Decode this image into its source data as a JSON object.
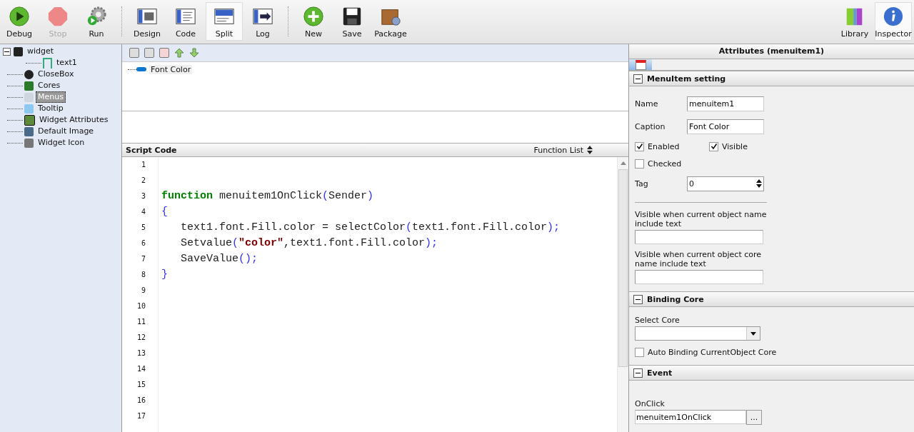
{
  "toolbar": {
    "groups": [
      [
        {
          "label": "Debug",
          "disabled": false,
          "selected": false
        },
        {
          "label": "Stop",
          "disabled": true,
          "selected": false
        },
        {
          "label": "Run",
          "disabled": false,
          "selected": false
        }
      ],
      [
        {
          "label": "Design",
          "disabled": false,
          "selected": false
        },
        {
          "label": "Code",
          "disabled": false,
          "selected": false
        },
        {
          "label": "Split",
          "disabled": false,
          "selected": true
        },
        {
          "label": "Log",
          "disabled": false,
          "selected": false
        }
      ],
      [
        {
          "label": "New",
          "disabled": false,
          "selected": false
        },
        {
          "label": "Save",
          "disabled": false,
          "selected": false
        },
        {
          "label": "Package",
          "disabled": false,
          "selected": false
        }
      ]
    ],
    "right": [
      {
        "label": "Library",
        "disabled": false,
        "selected": false
      },
      {
        "label": "Inspector",
        "disabled": false,
        "selected": true
      }
    ]
  },
  "tree": [
    {
      "label": "widget",
      "selected": false,
      "expanded": true,
      "children": [
        {
          "label": "text1",
          "selected": false
        }
      ]
    },
    {
      "label": "CloseBox",
      "selected": false
    },
    {
      "label": "Cores",
      "selected": false
    },
    {
      "label": "Menus",
      "selected": true
    },
    {
      "label": "Tooltip",
      "selected": false
    },
    {
      "label": "Widget Attributes",
      "selected": false
    },
    {
      "label": "Default Image",
      "selected": false
    },
    {
      "label": "Widget Icon",
      "selected": false
    }
  ],
  "menu_tree": [
    {
      "label": "Font Color",
      "selected": true
    }
  ],
  "script": {
    "title": "Script Code",
    "function_list": "Function List",
    "lines": [
      {
        "number": "1"
      },
      {
        "number": "2"
      },
      {
        "number": "3",
        "tokens": [
          {
            "kind": "keyword",
            "text": "function"
          },
          {
            "kind": "plain",
            "text": " menuitem1OnClick"
          },
          {
            "kind": "punct",
            "text": "("
          },
          {
            "kind": "plain",
            "text": "Sender"
          },
          {
            "kind": "punct",
            "text": ")"
          }
        ]
      },
      {
        "number": "4",
        "tokens": [
          {
            "kind": "punct",
            "text": "{"
          }
        ]
      },
      {
        "number": "5",
        "tokens": [
          {
            "kind": "plain",
            "text": "   text1.font.Fill.color = selectColor"
          },
          {
            "kind": "punct",
            "text": "("
          },
          {
            "kind": "plain",
            "text": "text1.font.Fill.color"
          },
          {
            "kind": "punct",
            "text": ");"
          }
        ]
      },
      {
        "number": "6",
        "tokens": [
          {
            "kind": "plain",
            "text": "   Setvalue"
          },
          {
            "kind": "punct",
            "text": "("
          },
          {
            "kind": "string",
            "text": "\"color\""
          },
          {
            "kind": "plain",
            "text": ",text1.font.Fill.color"
          },
          {
            "kind": "punct",
            "text": ");"
          }
        ]
      },
      {
        "number": "7",
        "tokens": [
          {
            "kind": "plain",
            "text": "   SaveValue"
          },
          {
            "kind": "punct",
            "text": "();"
          }
        ]
      },
      {
        "number": "8",
        "tokens": [
          {
            "kind": "punct",
            "text": "}"
          }
        ]
      },
      {
        "number": "9"
      },
      {
        "number": "10"
      },
      {
        "number": "11"
      },
      {
        "number": "12"
      },
      {
        "number": "13"
      },
      {
        "number": "14"
      },
      {
        "number": "15"
      },
      {
        "number": "16"
      },
      {
        "number": "17"
      }
    ]
  },
  "inspector": {
    "title": "Attributes (menuitem1)",
    "sections": [
      {
        "title": "MenuItem setting",
        "rows": [
          {
            "kind": "field",
            "label": "Name",
            "value": "menuitem1"
          },
          {
            "kind": "field",
            "label": "Caption",
            "value": "Font Color"
          },
          {
            "kind": "checks",
            "items": [
              {
                "label": "Enabled",
                "checked": true
              },
              {
                "label": "Visible",
                "checked": true
              }
            ]
          },
          {
            "kind": "checks",
            "items": [
              {
                "label": "Checked",
                "checked": false
              }
            ]
          },
          {
            "kind": "spin",
            "label": "Tag",
            "value": "0"
          },
          {
            "kind": "rule"
          },
          {
            "kind": "wide",
            "label": "Visible when current object name include text"
          },
          {
            "kind": "wide",
            "label": "Visible when current object core name include text"
          }
        ]
      },
      {
        "title": "Binding Core",
        "rows": [
          {
            "kind": "select",
            "label": "Select Core"
          },
          {
            "kind": "checks",
            "items": [
              {
                "label": "Auto Binding CurrentObject Core",
                "checked": false
              }
            ]
          }
        ]
      },
      {
        "title": "Event",
        "rows": [
          {
            "kind": "event",
            "label": "OnClick",
            "value": "menuitem1OnClick",
            "button": "..."
          }
        ]
      }
    ]
  }
}
